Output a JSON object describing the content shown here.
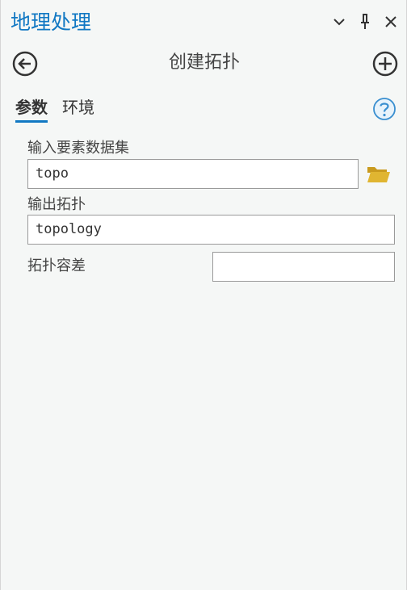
{
  "panel": {
    "title": "地理处理"
  },
  "tool": {
    "title": "创建拓扑"
  },
  "tabs": [
    {
      "label": "参数"
    },
    {
      "label": "环境"
    }
  ],
  "params": {
    "input_label": "输入要素数据集",
    "input_value": "topo",
    "output_label": "输出拓扑",
    "output_value": "topology",
    "tolerance_label": "拓扑容差",
    "tolerance_value": ""
  },
  "colors": {
    "accent": "#1178c3",
    "background": "#f5f7f6",
    "folder": "#e0b531"
  },
  "icons": {
    "collapse": "chevron-down-icon",
    "pin": "pin-icon",
    "close": "close-icon",
    "back": "back-arrow-icon",
    "add": "plus-circle-icon",
    "help": "help-icon",
    "browse": "folder-icon"
  }
}
